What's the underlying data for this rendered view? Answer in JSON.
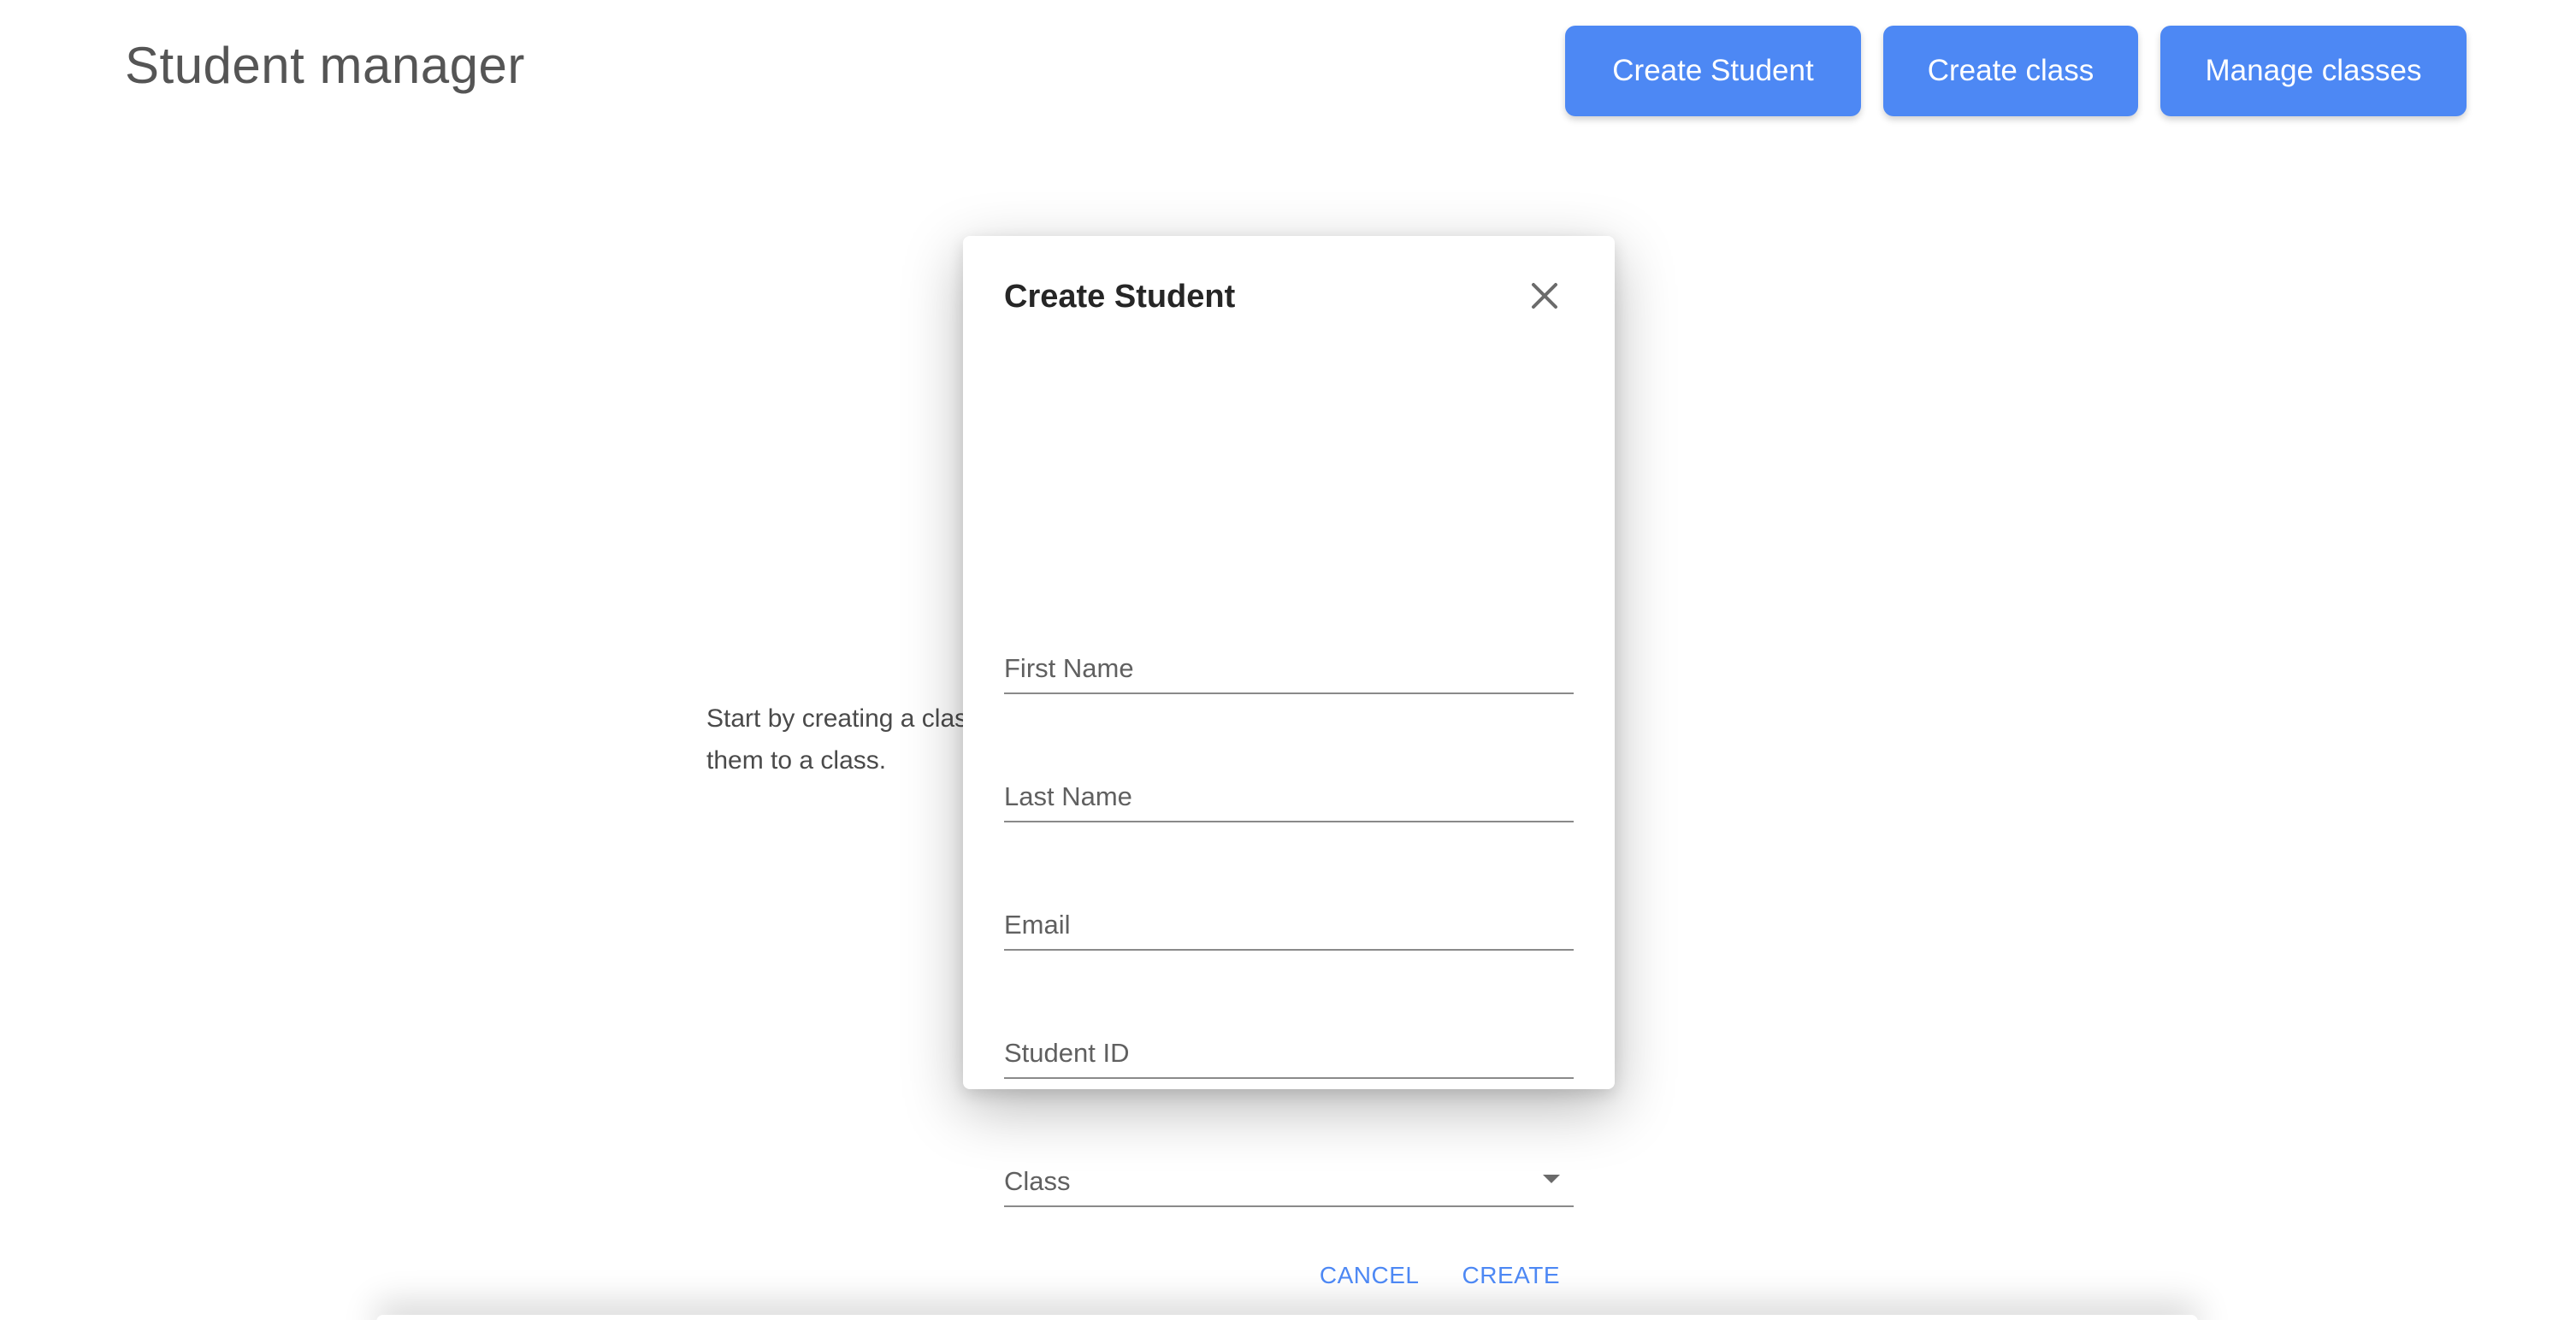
{
  "header": {
    "title": "Student manager",
    "buttons": {
      "create_student": "Create Student",
      "create_class": "Create class",
      "manage_classes": "Manage classes"
    }
  },
  "main": {
    "intro_line1": "Start by creating a class, then you can create students and assign",
    "intro_line2": "them to a class."
  },
  "modal": {
    "title": "Create Student",
    "close_icon": "close-icon",
    "fields": {
      "first_name": {
        "placeholder": "First Name",
        "value": ""
      },
      "last_name": {
        "placeholder": "Last Name",
        "value": ""
      },
      "email": {
        "placeholder": "Email",
        "value": ""
      },
      "student_id": {
        "placeholder": "Student ID",
        "value": ""
      },
      "class": {
        "label": "Class",
        "icon": "chevron-down-icon"
      }
    },
    "actions": {
      "cancel": "CANCEL",
      "create": "CREATE"
    }
  },
  "colors": {
    "primary": "#4d88f4",
    "text": "#4a4a4a",
    "title": "#555555"
  }
}
